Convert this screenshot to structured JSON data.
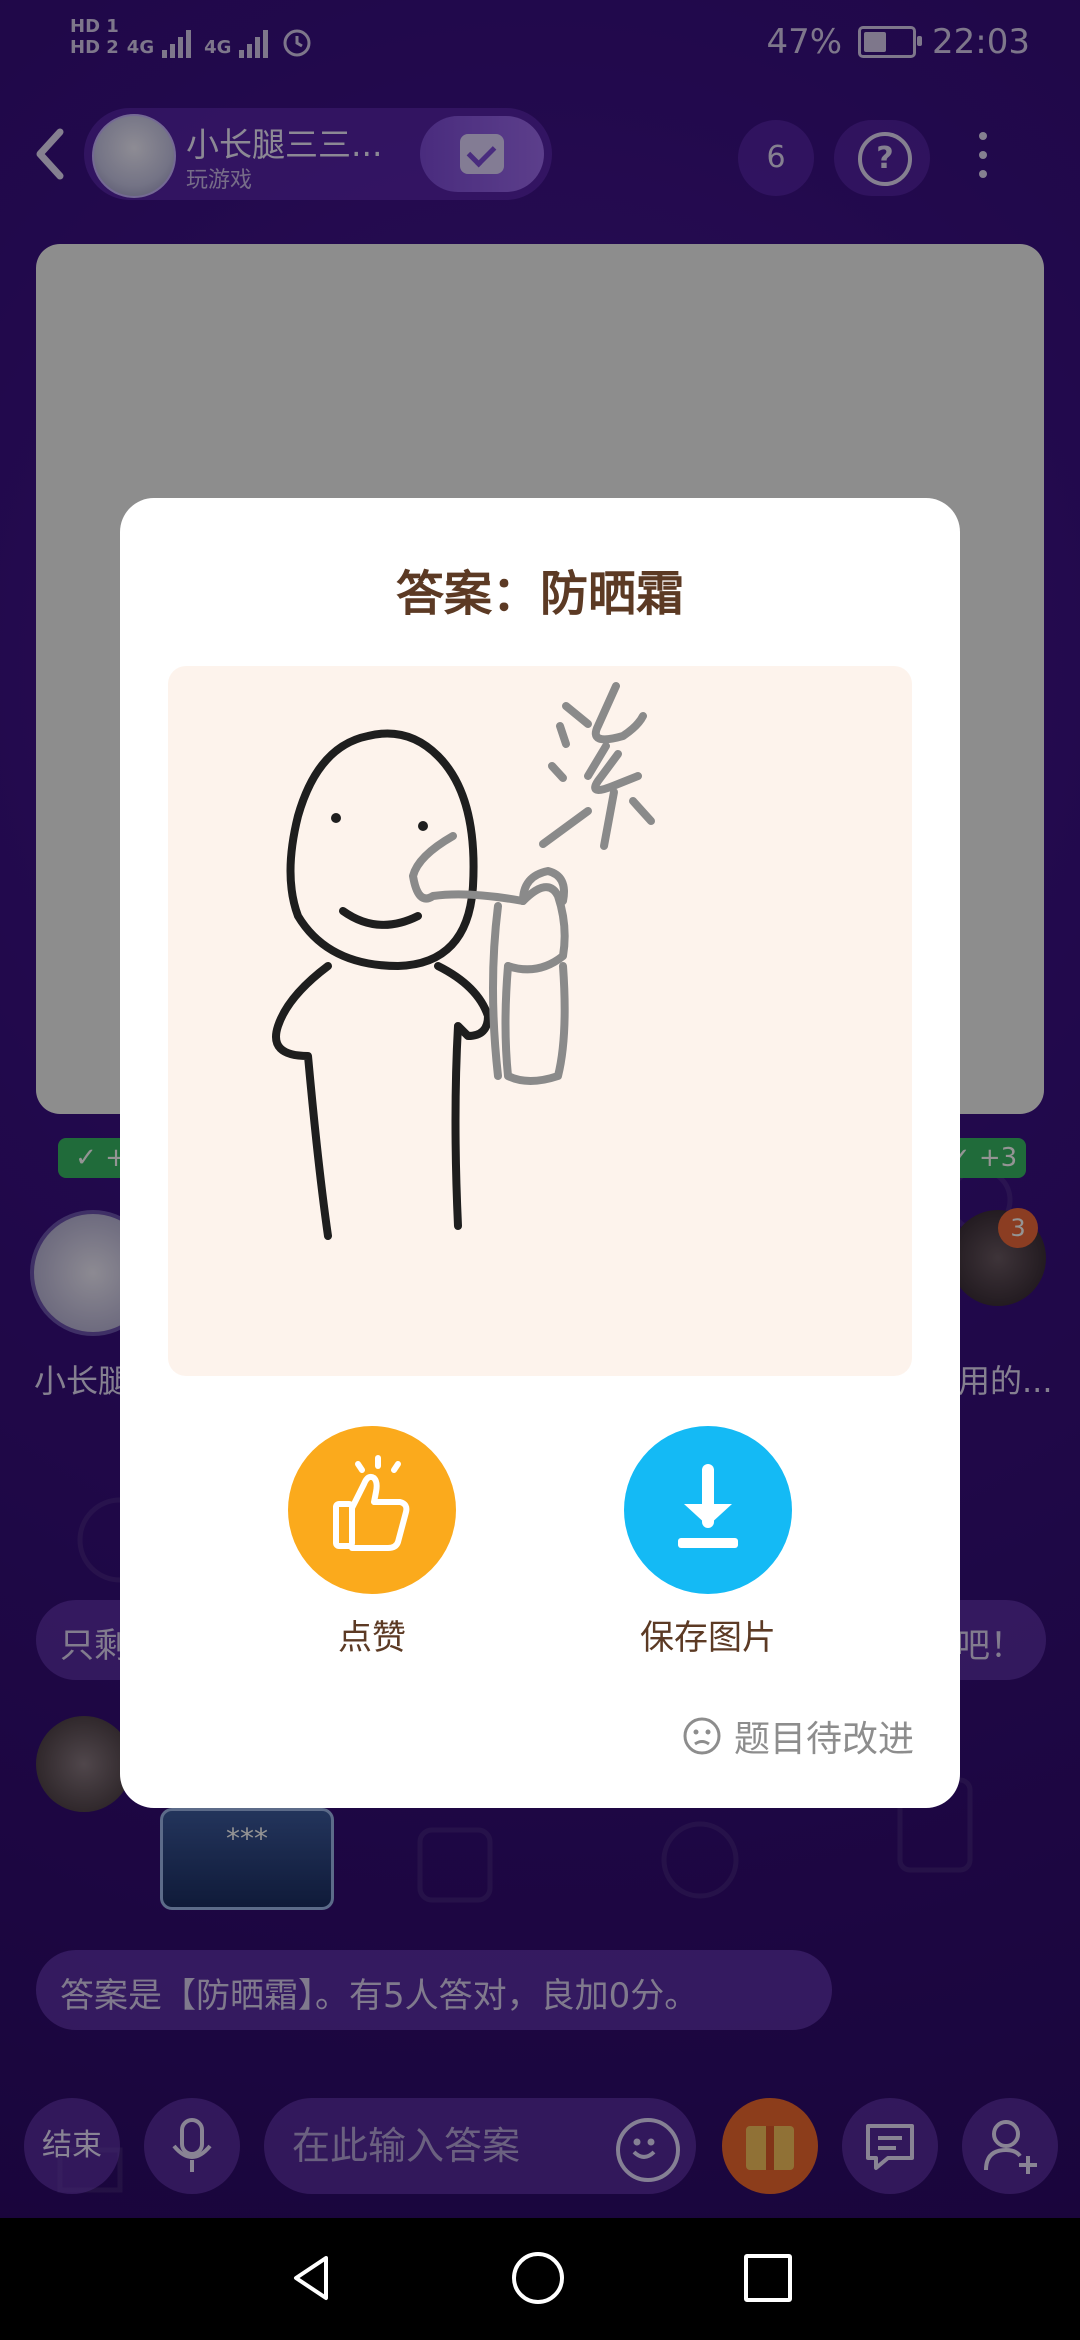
{
  "status_bar": {
    "hd1": "HD 1",
    "hd2": "HD 2",
    "net1": "4G",
    "net2": "4G",
    "battery_text": "47%",
    "battery_level": 0.47,
    "time": "22:03"
  },
  "header": {
    "room_title": "小长腿三三...",
    "room_subtitle": "玩游戏",
    "viewer_count": "6",
    "help_label": "?"
  },
  "players": {
    "left_badge": "✓ +",
    "right_badge": "✓ +3",
    "left_name": "小长腿",
    "right_name": "用的...",
    "right_count": "3"
  },
  "chat": {
    "hint_left": "只剩",
    "hint_right": "吧！",
    "mini_card_text": "***",
    "answer_message": "答案是【防晒霜】。有5人答对，良加0分。"
  },
  "bottom_bar": {
    "end_label": "结束",
    "input_placeholder": "在此输入答案"
  },
  "modal": {
    "title": "答案：防晒霜",
    "like_label": "点赞",
    "save_label": "保存图片",
    "feedback_label": "题目待改进",
    "drawing_text": "涂"
  },
  "colors": {
    "like": "#fbaa1c",
    "save": "#14baf5",
    "title": "#5c3a24",
    "background": "#3a1083"
  }
}
